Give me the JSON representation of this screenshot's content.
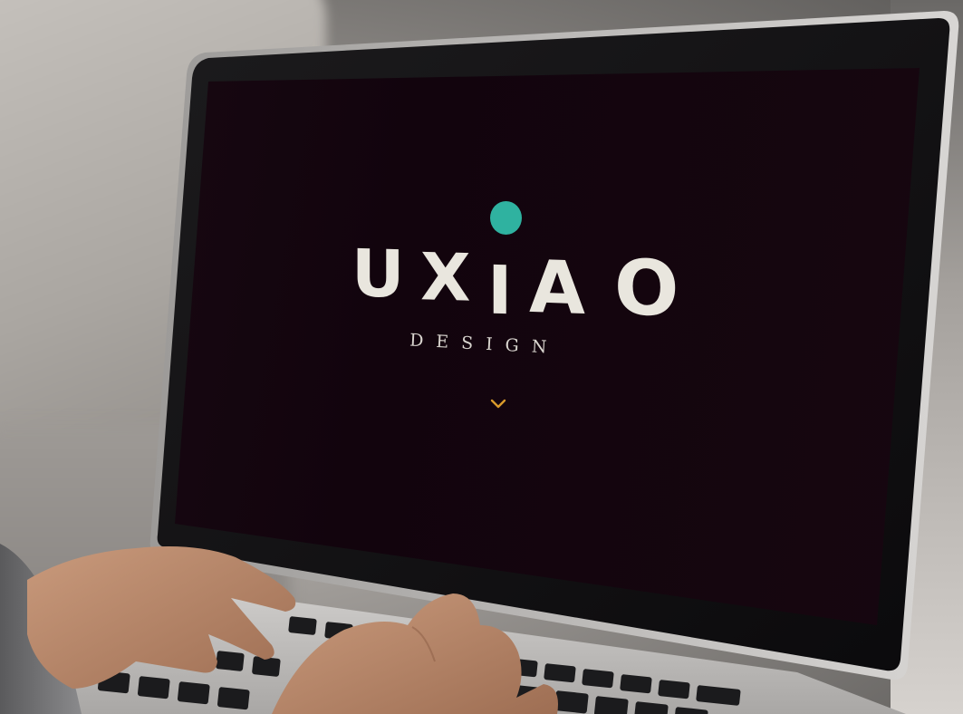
{
  "screen": {
    "brand": {
      "letters": [
        "U",
        "X",
        "I",
        "A",
        "O"
      ],
      "wordmark": "UXIAO",
      "subtitle": "DESIGN",
      "dot_color": "#2fb2a0",
      "text_color": "#e9e6de",
      "background_color": "#12040d"
    },
    "scroll_indicator": {
      "icon": "chevron-down-icon",
      "color": "#d99a2b"
    }
  },
  "scene": {
    "objects": [
      "laptop",
      "keyboard",
      "hands"
    ]
  }
}
